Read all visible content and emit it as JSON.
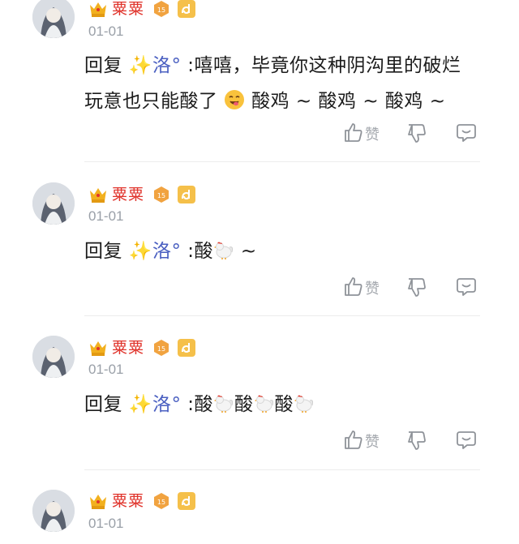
{
  "colors": {
    "username": "#e0342c",
    "mention": "#4a5fc1",
    "meta": "#9aa0a8",
    "text": "#1c1c1c",
    "divider": "#ececec"
  },
  "icons": {
    "crown": "crown-icon",
    "level": "level-badge-icon",
    "app": "app-badge-icon",
    "like": "thumbs-up-icon",
    "dislike": "thumbs-down-icon",
    "reply": "reply-bubble-icon",
    "rooster": "rooster-emoji",
    "yum": "yum-emoji",
    "sparkle": "sparkle-icon"
  },
  "comments": [
    {
      "username": "粟粟",
      "level": "15",
      "date": "01-01",
      "reply_prefix": "回复 ",
      "mention_name": "洛°",
      "line1": " :嘻嘻，毕竟你这种阴沟里的破烂",
      "line2a": "玩意也只能酸了",
      "line2b": "酸鸡 ~ 酸鸡 ~ 酸鸡 ~",
      "like_label": "赞"
    },
    {
      "username": "粟粟",
      "level": "15",
      "date": "01-01",
      "reply_prefix": "回复 ",
      "mention_name": "洛°",
      "text_a": " :酸",
      "text_b": " ~",
      "like_label": "赞"
    },
    {
      "username": "粟粟",
      "level": "15",
      "date": "01-01",
      "reply_prefix": "回复 ",
      "mention_name": "洛°",
      "text_a": " :酸",
      "text_b": "酸",
      "text_c": "酸",
      "like_label": "赞"
    },
    {
      "username": "粟粟",
      "level": "15",
      "date": "01-01"
    }
  ]
}
